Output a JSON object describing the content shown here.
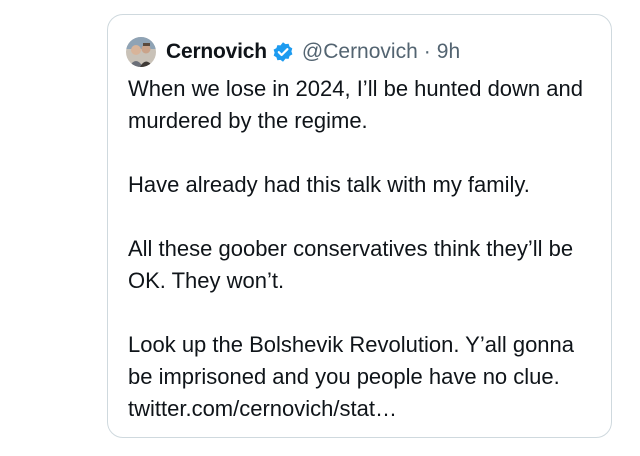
{
  "tweet": {
    "display_name": "Cernovich",
    "handle": "@Cernovich",
    "separator": "·",
    "time": "9h",
    "verified_color": "#1d9bf0",
    "avatar_icon": "profile-photo",
    "paragraphs": [
      "When we lose in 2024, I’ll be hunted down and murdered by the regime.",
      "Have already had this talk with my family.",
      "All these goober conservatives think they’ll be OK. They won’t.",
      "Look up the Bolshevik Revolution. Y’all gonna be imprisoned and you people have no clue. twitter.com/cernovich/stat…"
    ]
  }
}
